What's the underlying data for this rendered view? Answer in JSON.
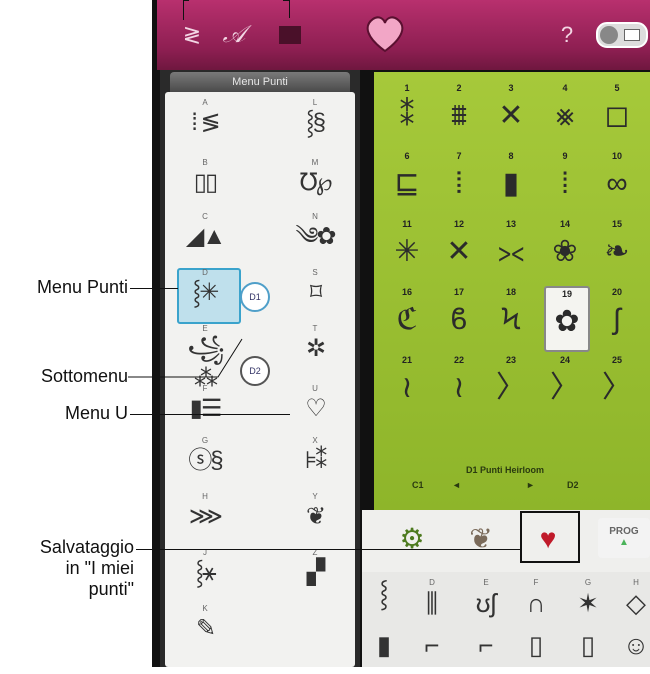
{
  "callouts": {
    "menu_punti": "Menu Punti",
    "sottomenu": "Sottomenu",
    "menu_u": "Menu U",
    "salvataggio": [
      "Salvataggio",
      "in \"I miei",
      "punti\""
    ]
  },
  "topbar": {
    "icons": [
      "zigzag-icon",
      "script-a-icon",
      "square-icon",
      "heart-icon",
      "help-icon",
      "toggle-icon"
    ],
    "help_label": "?"
  },
  "menu": {
    "title": "Menu Punti",
    "left_items": [
      {
        "letter": "A",
        "glyph": "⁞ ≶"
      },
      {
        "letter": "B",
        "glyph": "▯▯"
      },
      {
        "letter": "C",
        "glyph": "◢▲"
      },
      {
        "letter": "D",
        "glyph": "⸾✳"
      },
      {
        "letter": "E",
        "glyph": "꧁⁂"
      },
      {
        "letter": "F",
        "glyph": "▮☰"
      },
      {
        "letter": "G",
        "glyph": "ⓢ§"
      },
      {
        "letter": "H",
        "glyph": "⋙"
      },
      {
        "letter": "J",
        "glyph": "⸾⚹"
      },
      {
        "letter": "K",
        "glyph": "✎"
      }
    ],
    "right_items": [
      {
        "letter": "L",
        "glyph": "⸾§"
      },
      {
        "letter": "M",
        "glyph": "℧℘"
      },
      {
        "letter": "N",
        "glyph": "༄✿"
      },
      {
        "letter": "S",
        "glyph": "⌑"
      },
      {
        "letter": "T",
        "glyph": "✲"
      },
      {
        "letter": "U",
        "glyph": "♡"
      },
      {
        "letter": "X",
        "glyph": "⊧⁑"
      },
      {
        "letter": "Y",
        "glyph": "❦"
      },
      {
        "letter": "Z",
        "glyph": "▞"
      }
    ],
    "sub_buttons": [
      "D1",
      "D2"
    ]
  },
  "stitches": [
    {
      "num": "1",
      "glyph": "⁑"
    },
    {
      "num": "2",
      "glyph": "⩩"
    },
    {
      "num": "3",
      "glyph": "✕"
    },
    {
      "num": "4",
      "glyph": "⨳"
    },
    {
      "num": "5",
      "glyph": "◻"
    },
    {
      "num": "6",
      "glyph": "⊑"
    },
    {
      "num": "7",
      "glyph": "⦙"
    },
    {
      "num": "8",
      "glyph": "▮"
    },
    {
      "num": "9",
      "glyph": "⁞"
    },
    {
      "num": "10",
      "glyph": "∞"
    },
    {
      "num": "11",
      "glyph": "✳"
    },
    {
      "num": "12",
      "glyph": "✕"
    },
    {
      "num": "13",
      "glyph": "⪥"
    },
    {
      "num": "14",
      "glyph": "❀"
    },
    {
      "num": "15",
      "glyph": "❧"
    },
    {
      "num": "16",
      "glyph": "ℭ"
    },
    {
      "num": "17",
      "glyph": "ϐ"
    },
    {
      "num": "18",
      "glyph": "Ϟ"
    },
    {
      "num": "19",
      "glyph": "✿"
    },
    {
      "num": "20",
      "glyph": "ʃ"
    },
    {
      "num": "21",
      "glyph": "≀"
    },
    {
      "num": "22",
      "glyph": "≀"
    },
    {
      "num": "23",
      "glyph": "〉"
    },
    {
      "num": "24",
      "glyph": "〉"
    },
    {
      "num": "25",
      "glyph": "〉"
    }
  ],
  "selected_stitch": "19",
  "category": {
    "label": "D1 Punti Heirloom",
    "prev": "C1",
    "next": "D2",
    "prev_arrow": "◄",
    "next_arrow": "►"
  },
  "bottom_buttons": {
    "prog_label": "PROG",
    "icons": [
      "settings-icon",
      "pattern-icon",
      "save-heart-icon"
    ]
  },
  "strip": [
    {
      "letter": "",
      "glyph": "⸾"
    },
    {
      "letter": "D",
      "glyph": "⫼"
    },
    {
      "letter": "E",
      "glyph": "ʊʃ"
    },
    {
      "letter": "F",
      "glyph": "∩"
    },
    {
      "letter": "G",
      "glyph": "✶"
    },
    {
      "letter": "H",
      "glyph": "◇"
    }
  ],
  "strip_lower": [
    "▮",
    "⌐",
    "⌐",
    "▯",
    "▯",
    "☺"
  ]
}
